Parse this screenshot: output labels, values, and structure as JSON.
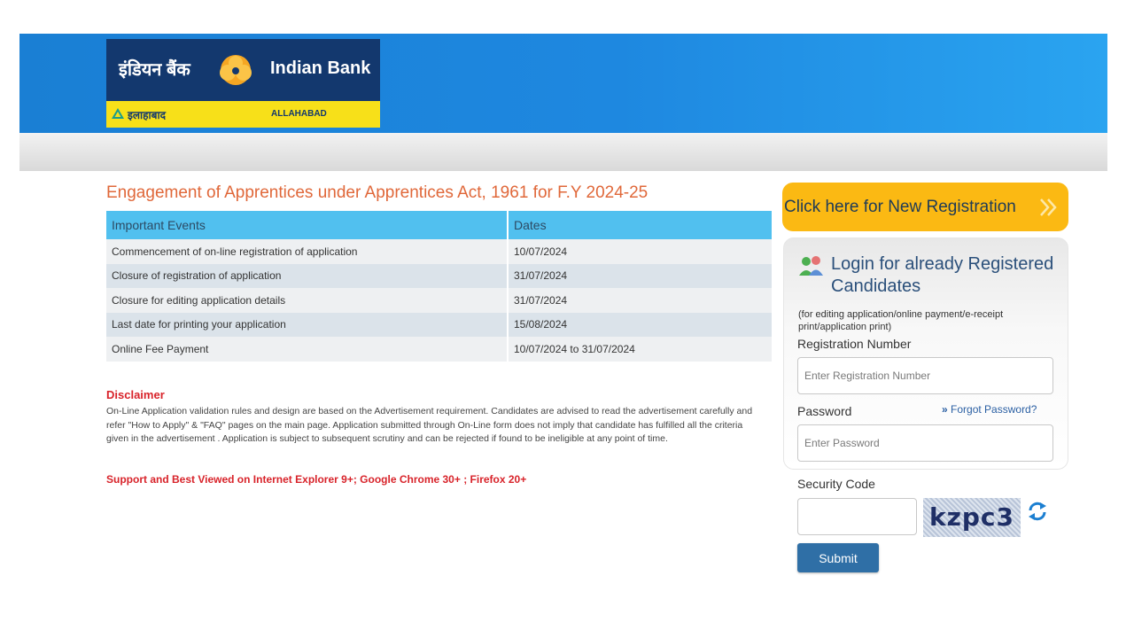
{
  "header": {
    "logo_hindi": "इंडियन बैंक",
    "logo_english": "Indian Bank",
    "strip_hindi": "इलाहाबाद",
    "strip_english": "ALLAHABAD"
  },
  "main": {
    "title": "Engagement of Apprentices under Apprentices Act, 1961 for F.Y 2024-25",
    "table": {
      "headers": [
        "Important Events",
        "Dates"
      ],
      "rows": [
        [
          "Commencement of on-line registration of application",
          "10/07/2024"
        ],
        [
          "Closure of registration of application",
          "31/07/2024"
        ],
        [
          "Closure for editing application details",
          "31/07/2024"
        ],
        [
          "Last date for printing your application",
          "15/08/2024"
        ],
        [
          "Online Fee Payment",
          "10/07/2024 to 31/07/2024"
        ]
      ]
    },
    "disclaimer_title": "Disclaimer",
    "disclaimer_text": "On-Line Application validation rules and design are based on the Advertisement requirement. Candidates are advised to read the advertisement carefully and refer \"How to Apply\" & \"FAQ\" pages on the main page. Application submitted through On-Line form does not imply that candidate has fulfilled all the criteria given in the advertisement . Application is subject to subsequent scrutiny and can be rejected if found to be ineligible at any point of time.",
    "support_text": "Support and Best Viewed on Internet Explorer 9+; Google Chrome 30+ ; Firefox 20+"
  },
  "sidebar": {
    "new_registration_label": "Click here for New Registration",
    "login_heading": "Login for already Registered Candidates",
    "login_note": "(for editing application/online payment/e-receipt print/application print)",
    "registration_label": "Registration Number",
    "registration_placeholder": "Enter Registration Number",
    "password_label": "Password",
    "password_placeholder": "Enter Password",
    "forgot_label": "Forgot Password?",
    "security_label": "Security Code",
    "captcha_text": "kzpc3",
    "submit_label": "Submit"
  },
  "colors": {
    "header_blue": "#1e88e0",
    "logo_navy": "#13386e",
    "logo_yellow": "#f7e019",
    "title_orange": "#e0683a",
    "table_header": "#51c0ef",
    "accent_red": "#d8232a",
    "registration_button": "#fbb913",
    "submit_button": "#2f6fa6"
  },
  "icons": [
    "bank-emblem-icon",
    "triangle-logo-icon",
    "chevron-right-icon",
    "users-icon",
    "double-chevron-icon",
    "refresh-icon"
  ]
}
